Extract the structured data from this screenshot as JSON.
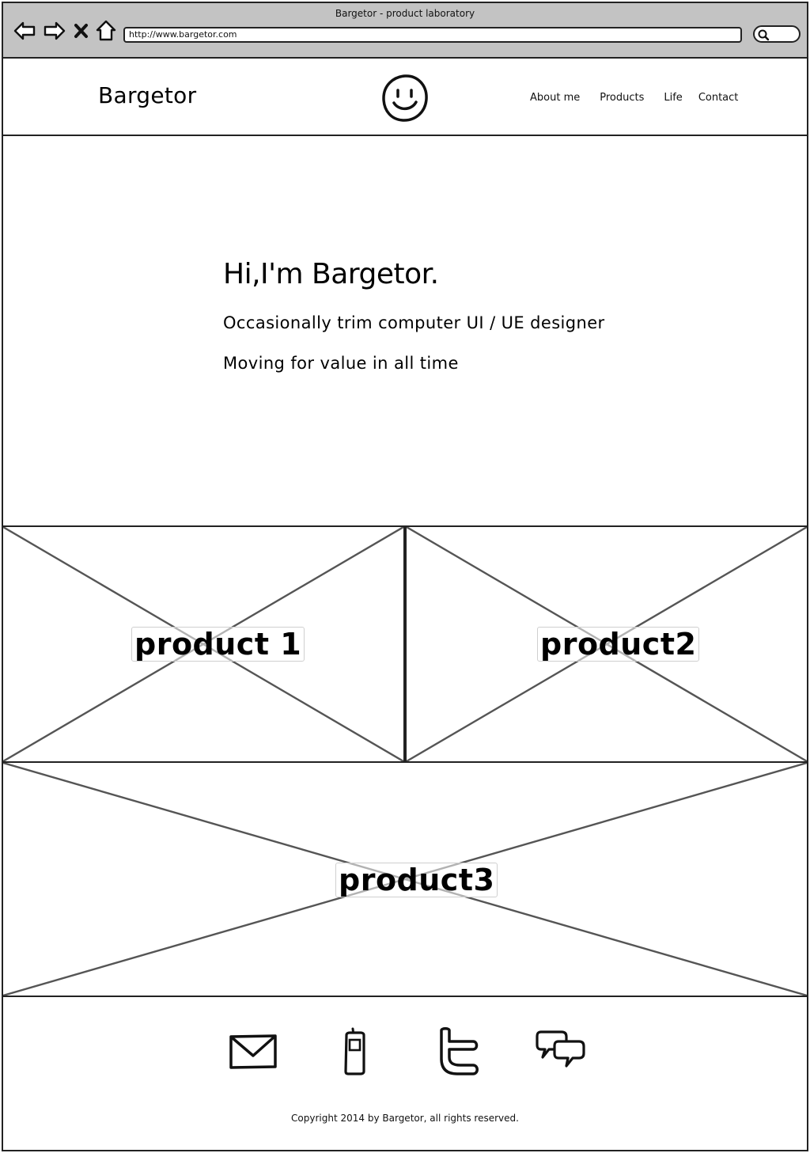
{
  "browser": {
    "window_title": "Bargetor - product laboratory",
    "url": "http://www.bargetor.com",
    "icons": [
      "back-arrow-icon",
      "forward-arrow-icon",
      "close-x-icon",
      "home-icon",
      "search-icon"
    ]
  },
  "header": {
    "brand": "Bargetor",
    "logo_icon": "smiley-face-icon",
    "menu": [
      {
        "label": "About me"
      },
      {
        "label": "Products"
      },
      {
        "label": "Life"
      },
      {
        "label": "Contact"
      }
    ]
  },
  "hero": {
    "title": "Hi,I'm Bargetor.",
    "line1": "Occasionally trim computer UI / UE designer",
    "line2": "Moving for value in all time"
  },
  "products": [
    {
      "label": "product 1"
    },
    {
      "label": "product2"
    },
    {
      "label": "product3"
    }
  ],
  "footer": {
    "icons": [
      "mail-icon",
      "phone-icon",
      "twitter-icon",
      "chat-icon"
    ],
    "copyright": "Copyright 2014 by Bargetor, all rights reserved."
  },
  "colors": {
    "chrome_bg": "#c3c3c3",
    "line": "#222222",
    "placeholder_cross": "#555555"
  }
}
